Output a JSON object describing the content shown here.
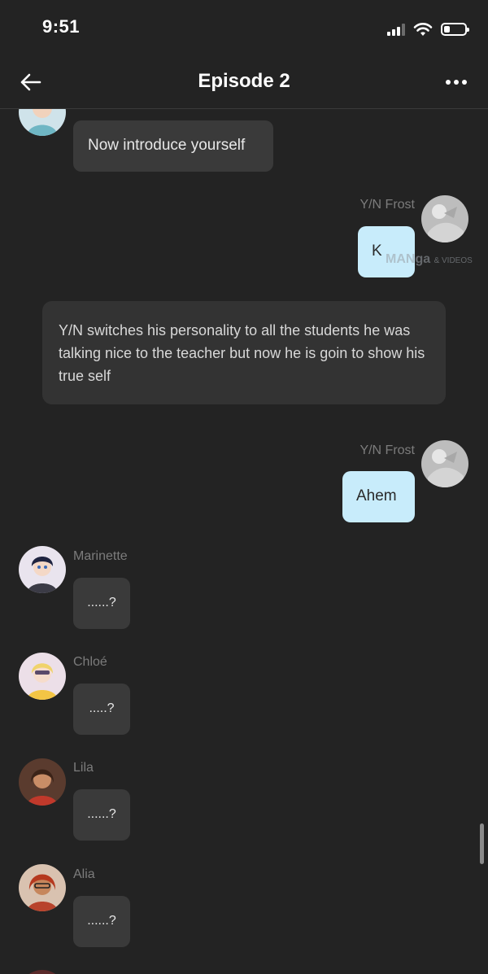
{
  "status_bar": {
    "time": "9:51",
    "signal_bars_active": 3,
    "signal_bars_total": 4,
    "battery_level": 0.3
  },
  "nav": {
    "title": "Episode 2",
    "back_icon": "arrow-left-icon",
    "more_icon": "more-horizontal-icon"
  },
  "chat": {
    "messages": [
      {
        "type": "incoming",
        "name": "",
        "text": "Now introduce yourself"
      },
      {
        "type": "outgoing",
        "name": "Y/N Frost",
        "text": "K"
      },
      {
        "type": "narration",
        "text": "Y/N switches his personality to all the students he was talking nice to the teacher but now he is goin to show his true self"
      },
      {
        "type": "outgoing",
        "name": "Y/N Frost",
        "text": "Ahem"
      },
      {
        "type": "incoming",
        "name": "Marinette",
        "text": "......?"
      },
      {
        "type": "incoming",
        "name": "Chloé",
        "text": ".....?"
      },
      {
        "type": "incoming",
        "name": "Lila",
        "text": "......?"
      },
      {
        "type": "incoming",
        "name": "Alia",
        "text": "......?"
      }
    ],
    "watermark_text": "MANga",
    "watermark_small": "& VIDEOS"
  },
  "colors": {
    "background": "#232323",
    "incoming_bubble": "#3a3a3a",
    "outgoing_bubble": "#c8ecfb",
    "narration_bubble": "#333333",
    "name_text": "#7c7c7c"
  }
}
